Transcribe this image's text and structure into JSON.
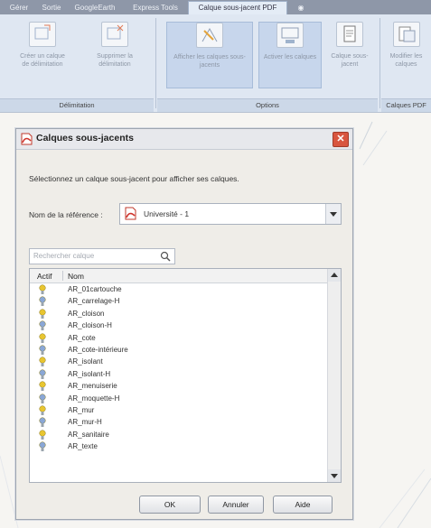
{
  "ribbon": {
    "tabs": [
      "Gérer",
      "Sortie",
      "GoogleEarth",
      "Express Tools",
      "Calque sous-jacent PDF"
    ],
    "tools": [
      {
        "label": "Créer un calque de délimitation"
      },
      {
        "label": "Supprimer la délimitation"
      },
      {
        "label": "Afficher les calques sous-jacents"
      },
      {
        "label": "Activer les calques"
      },
      {
        "label": "Calque sous-jacent"
      },
      {
        "label": "Modifier les calques"
      }
    ],
    "panels": [
      "Délimitation",
      "Options",
      "Calques PDF"
    ]
  },
  "dialog": {
    "title": "Calques sous-jacents",
    "close_glyph": "✕",
    "instruction": "Sélectionnez un calque sous-jacent pour afficher ses calques.",
    "reference_label": "Nom de la référence :",
    "reference_value": "Université - 1",
    "search_placeholder": "Rechercher calque",
    "columns": [
      "Actif",
      "Nom"
    ],
    "layers": [
      {
        "name": "AR_01cartouche",
        "active": true
      },
      {
        "name": "AR_carrelage-H",
        "active": true
      },
      {
        "name": "AR_cloison",
        "active": true
      },
      {
        "name": "AR_cloison-H",
        "active": true
      },
      {
        "name": "AR_cote",
        "active": true
      },
      {
        "name": "AR_cote-intérieure",
        "active": true
      },
      {
        "name": "AR_isolant",
        "active": true
      },
      {
        "name": "AR_isolant-H",
        "active": true
      },
      {
        "name": "AR_menuiserie",
        "active": true
      },
      {
        "name": "AR_moquette-H",
        "active": true
      },
      {
        "name": "AR_mur",
        "active": true
      },
      {
        "name": "AR_mur-H",
        "active": true
      },
      {
        "name": "AR_sanitaire",
        "active": true
      },
      {
        "name": "AR_texte",
        "active": true
      }
    ],
    "buttons": {
      "ok": "OK",
      "cancel": "Annuler",
      "help": "Aide"
    }
  },
  "colors": {
    "bulb": "#e8c531",
    "pdf_icon": "#d0342c",
    "accent": "#c7d6ec"
  }
}
